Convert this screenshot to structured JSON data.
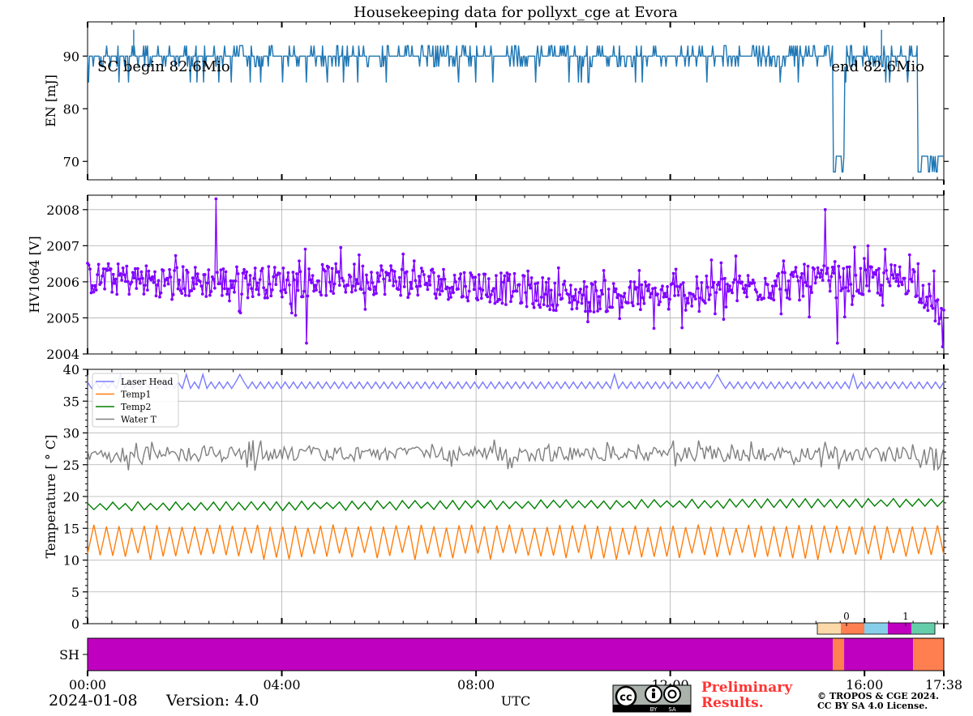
{
  "title": "Housekeeping data for pollyxt_cge at Evora",
  "footer": {
    "date": "2024-01-08",
    "version": "Version: 4.0",
    "xlabel": "UTC",
    "preliminary_line1": "Preliminary",
    "preliminary_line2": "Results.",
    "copyright_line1": "© TROPOS & CGE 2024.",
    "copyright_line2": "CC BY SA 4.0 License.",
    "cc_badge_text": "cc",
    "cc_by": "BY",
    "cc_sa": "SA"
  },
  "colors": {
    "energy": "#1f77b4",
    "hv": "#8000ff",
    "laser_head": "#7b7bff",
    "temp1": "#ff7f0e",
    "temp2": "#008000",
    "water_t": "#808080",
    "shutter_closed": "#c000c0",
    "shutter_open": "#ff7f50",
    "bar_peach": "#fcd9a8",
    "bar_coral": "#ff7f50",
    "bar_sky": "#87ceeb",
    "bar_magenta": "#c000c0",
    "bar_teal": "#66cdaa"
  },
  "chart_data": [
    {
      "type": "line",
      "panel": "energy",
      "ylabel": "EN [mJ]",
      "ylim": [
        66.5,
        96.5
      ],
      "yticks": [
        70,
        80,
        90
      ],
      "xlim_hours": [
        0,
        17.633
      ],
      "xtick_labels": [
        "00:00",
        "04:00",
        "08:00",
        "12:00",
        "16:00",
        "17:38"
      ],
      "xtick_hours": [
        0,
        4,
        8,
        12,
        16,
        17.633
      ],
      "grid": false,
      "annotations": [
        "SC begin 82.6Mio",
        "end 82.6Mio"
      ],
      "series": [
        {
          "name": "",
          "color_key": "energy",
          "baseline": 90,
          "spikes_up_to": 92,
          "spikes_down_to": 85,
          "max_spike": 95,
          "segments": [
            {
              "x_start": 0,
              "x_end": 15.35,
              "level": 90
            },
            {
              "x_start": 15.35,
              "x_end": 15.58,
              "level": 71
            },
            {
              "x_start": 15.58,
              "x_end": 17.1,
              "level": 90
            },
            {
              "x_start": 17.1,
              "x_end": 17.633,
              "level": 71
            }
          ]
        }
      ]
    },
    {
      "type": "line",
      "panel": "hv1064",
      "ylabel": "HV1064 [V]",
      "ylim": [
        2004,
        2008.4
      ],
      "yticks": [
        2004,
        2005,
        2006,
        2007,
        2008
      ],
      "grid": true,
      "markers": true,
      "series": [
        {
          "name": "",
          "color_key": "hv",
          "trend_x": [
            0,
            2,
            4,
            6,
            8,
            10,
            12,
            14,
            15,
            16,
            17,
            17.633
          ],
          "trend_y": [
            2006.1,
            2006.0,
            2006.0,
            2006.1,
            2005.9,
            2005.6,
            2005.6,
            2005.9,
            2006.0,
            2006.0,
            2006.1,
            2005.0
          ],
          "spread": 0.45,
          "peaks": [
            [
              2.65,
              2008.3
            ],
            [
              15.2,
              2008.0
            ],
            [
              4.5,
              2004.3
            ],
            [
              15.45,
              2004.3
            ],
            [
              17.6,
              2004.2
            ]
          ]
        }
      ]
    },
    {
      "type": "line",
      "panel": "temperature",
      "ylabel": "Temperature [$^\\circ C$]",
      "ylabel_display": "Temperature [ ° C]",
      "ylim": [
        0,
        40
      ],
      "yticks": [
        0,
        5,
        10,
        15,
        20,
        25,
        30,
        35,
        40
      ],
      "grid": true,
      "legend": "upper-left",
      "series": [
        {
          "name": "Laser Head",
          "color_key": "laser_head",
          "low": 37.0,
          "high": 38.0,
          "period_h": 0.17
        },
        {
          "name": "Temp1",
          "color_key": "temp1",
          "low": 10,
          "high": 15,
          "period_h": 0.26
        },
        {
          "name": "Temp2",
          "color_key": "temp2",
          "low": 17.8,
          "high": 19.0,
          "period_h": 0.26,
          "drift_end": 19.6
        },
        {
          "name": "Water T",
          "color_key": "water_t",
          "low": 25.5,
          "high": 27.8,
          "period_h": 0.08
        }
      ],
      "colorbar_labels": [
        "0",
        "1"
      ]
    },
    {
      "type": "heatmap",
      "panel": "shutter",
      "ylabel": "SH",
      "segments": [
        {
          "x_start": 0,
          "x_end": 15.35,
          "state": "closed"
        },
        {
          "x_start": 15.35,
          "x_end": 15.58,
          "state": "open"
        },
        {
          "x_start": 15.58,
          "x_end": 17.0,
          "state": "closed"
        },
        {
          "x_start": 17.0,
          "x_end": 17.633,
          "state": "open"
        }
      ]
    }
  ]
}
